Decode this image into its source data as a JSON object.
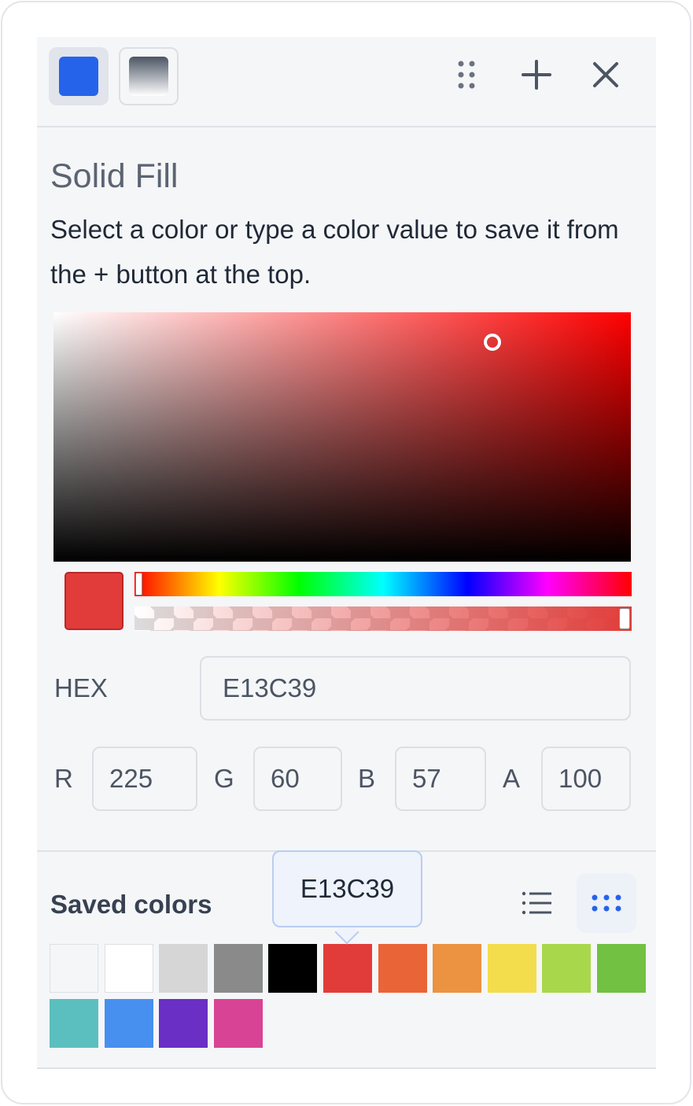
{
  "toolbar": {
    "modes": [
      {
        "name": "solid",
        "color": "#2563eb"
      },
      {
        "name": "gradient"
      }
    ],
    "icons": [
      "drag-handle-icon",
      "plus-icon",
      "close-icon"
    ]
  },
  "picker": {
    "title": "Solid Fill",
    "description": "Select a color or type a color value to save it from the + button at the top.",
    "hue_color": "#ff0000",
    "saturation": 0.76,
    "brightness": 0.88,
    "hue": 0,
    "alpha": 1.0,
    "current_color": "#E13C39",
    "hex_label": "HEX",
    "hex_value": "E13C39",
    "r_label": "R",
    "r_value": "225",
    "g_label": "G",
    "g_value": "60",
    "b_label": "B",
    "b_value": "57",
    "a_label": "A",
    "a_value": "100"
  },
  "saved": {
    "title": "Saved colors",
    "tooltip": "E13C39",
    "colors": [
      "#f5f6f8",
      "#ffffff",
      "#d6d6d6",
      "#8a8a8a",
      "#000000",
      "#e13c39",
      "#e96437",
      "#eb9340",
      "#f3dd4c",
      "#a8d74b",
      "#72c142",
      "#5bbfbf",
      "#4790f0",
      "#6a2fc4",
      "#d84396"
    ]
  }
}
